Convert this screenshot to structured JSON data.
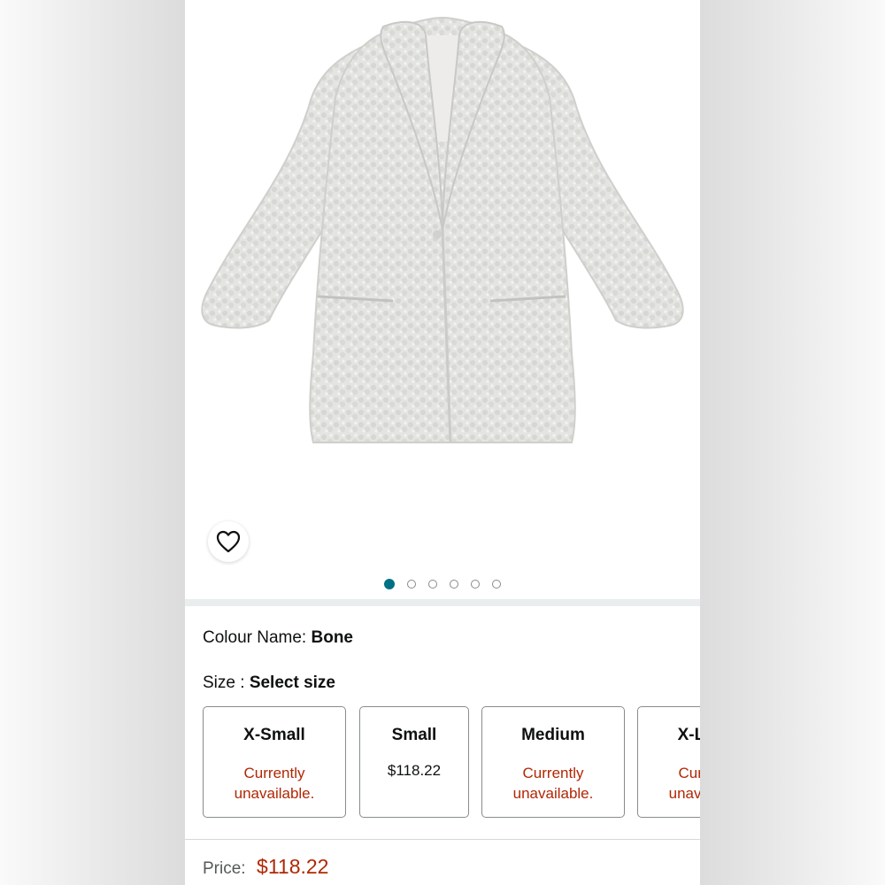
{
  "product": {
    "carousel": {
      "slide_count": 6,
      "active_index": 0
    },
    "wishlist_icon": "heart-outline-icon"
  },
  "colour": {
    "label": "Colour Name:",
    "value": "Bone"
  },
  "size": {
    "label": "Size :",
    "value": "Select size",
    "options": [
      {
        "name": "X-Small",
        "status": "Currently unavailable."
      },
      {
        "name": "Small",
        "price": "$118.22"
      },
      {
        "name": "Medium",
        "status": "Currently unavailable."
      },
      {
        "name": "X-Large",
        "status": "Currently unavailable."
      }
    ]
  },
  "price": {
    "label": "Price:",
    "value": "$118.22"
  },
  "colors": {
    "accent_teal": "#007185",
    "price_red": "#b12704",
    "text_dark": "#0f1111",
    "coat_bone": "#e3e3e1"
  }
}
